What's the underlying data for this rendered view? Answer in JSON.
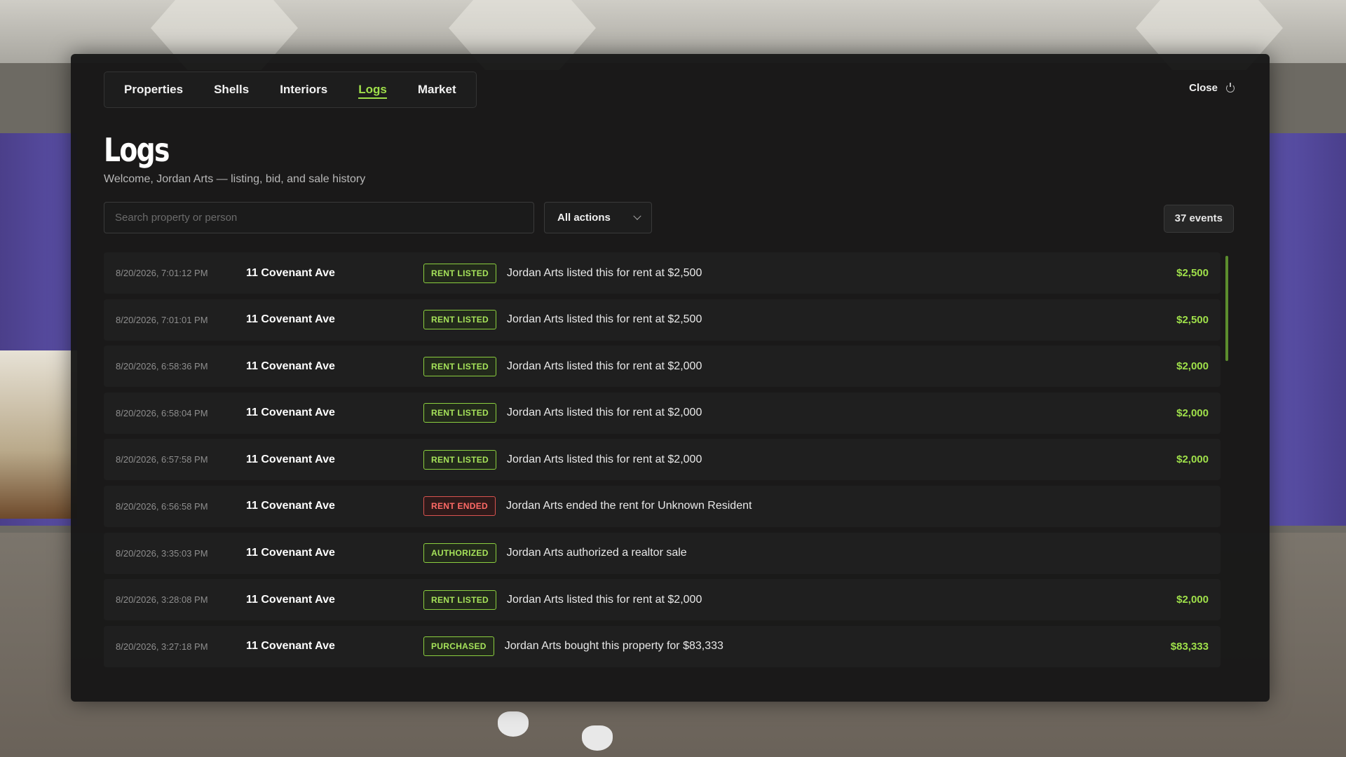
{
  "tabs": [
    {
      "label": "Properties",
      "active": false
    },
    {
      "label": "Shells",
      "active": false
    },
    {
      "label": "Interiors",
      "active": false
    },
    {
      "label": "Logs",
      "active": true
    },
    {
      "label": "Market",
      "active": false
    }
  ],
  "close_label": "Close",
  "page": {
    "title": "Logs",
    "subtitle": "Welcome, Jordan Arts — listing, bid, and sale history"
  },
  "filters": {
    "search_placeholder": "Search property or person",
    "action_select": "All actions",
    "event_count": "37 events"
  },
  "colors": {
    "accent_green": "#9fe04a",
    "danger_red": "#ff6a66",
    "panel_bg": "#161616"
  },
  "logs": [
    {
      "time": "8/20/2026, 7:01:12 PM",
      "property": "11 Covenant Ave",
      "action": "RENT LISTED",
      "status": "green",
      "description": "Jordan Arts listed this for rent at $2,500",
      "amount": "$2,500"
    },
    {
      "time": "8/20/2026, 7:01:01 PM",
      "property": "11 Covenant Ave",
      "action": "RENT LISTED",
      "status": "green",
      "description": "Jordan Arts listed this for rent at $2,500",
      "amount": "$2,500"
    },
    {
      "time": "8/20/2026, 6:58:36 PM",
      "property": "11 Covenant Ave",
      "action": "RENT LISTED",
      "status": "green",
      "description": "Jordan Arts listed this for rent at $2,000",
      "amount": "$2,000"
    },
    {
      "time": "8/20/2026, 6:58:04 PM",
      "property": "11 Covenant Ave",
      "action": "RENT LISTED",
      "status": "green",
      "description": "Jordan Arts listed this for rent at $2,000",
      "amount": "$2,000"
    },
    {
      "time": "8/20/2026, 6:57:58 PM",
      "property": "11 Covenant Ave",
      "action": "RENT LISTED",
      "status": "green",
      "description": "Jordan Arts listed this for rent at $2,000",
      "amount": "$2,000"
    },
    {
      "time": "8/20/2026, 6:56:58 PM",
      "property": "11 Covenant Ave",
      "action": "RENT ENDED",
      "status": "red",
      "description": "Jordan Arts ended the rent for Unknown Resident",
      "amount": ""
    },
    {
      "time": "8/20/2026, 3:35:03 PM",
      "property": "11 Covenant Ave",
      "action": "AUTHORIZED",
      "status": "green",
      "description": "Jordan Arts authorized a realtor sale",
      "amount": ""
    },
    {
      "time": "8/20/2026, 3:28:08 PM",
      "property": "11 Covenant Ave",
      "action": "RENT LISTED",
      "status": "green",
      "description": "Jordan Arts listed this for rent at $2,000",
      "amount": "$2,000"
    },
    {
      "time": "8/20/2026, 3:27:18 PM",
      "property": "11 Covenant Ave",
      "action": "PURCHASED",
      "status": "green",
      "description": "Jordan Arts bought this property for $83,333",
      "amount": "$83,333"
    }
  ]
}
